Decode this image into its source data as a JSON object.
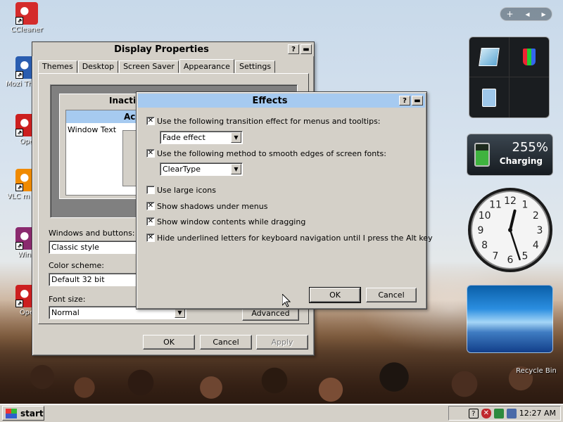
{
  "desktop_icons": [
    {
      "label": "CCleaner",
      "icon": "ccleaner-icon",
      "color": "#d42b2b"
    },
    {
      "label": "Mozi Thunde",
      "icon": "thunderbird-icon",
      "color": "#2a5db0"
    },
    {
      "label": "Ope",
      "icon": "opera-icon",
      "color": "#cc1f1f"
    },
    {
      "label": "VLC m play",
      "icon": "vlc-icon",
      "color": "#f08a00"
    },
    {
      "label": "WinR",
      "icon": "winrar-icon",
      "color": "#8a2a6e"
    },
    {
      "label": "Ope",
      "icon": "opera-icon",
      "color": "#cc1f1f"
    }
  ],
  "display_properties": {
    "title": "Display Properties",
    "help_label": "?",
    "tabs": [
      "Themes",
      "Desktop",
      "Screen Saver",
      "Appearance",
      "Settings"
    ],
    "active_tab": "Appearance",
    "preview": {
      "inactive_title": "Inacti",
      "active_title": "Ac",
      "window_text": "Window Text"
    },
    "windows_buttons_label": "Windows and buttons:",
    "windows_buttons_value": "Classic style",
    "color_scheme_label": "Color scheme:",
    "color_scheme_value": "Default 32 bit",
    "font_size_label": "Font size:",
    "font_size_value": "Normal",
    "advanced_label": "Advanced",
    "ok_label": "OK",
    "cancel_label": "Cancel",
    "apply_label": "Apply"
  },
  "effects": {
    "title": "Effects",
    "help_label": "?",
    "transition_label": "Use the following transition effect for menus and tooltips:",
    "transition_checked": true,
    "transition_value": "Fade effect",
    "smooth_label": "Use the following method to smooth edges of screen fonts:",
    "smooth_checked": true,
    "smooth_value": "ClearType",
    "large_icons_label": "Use large icons",
    "large_icons_checked": false,
    "shadows_label": "Show shadows under menus",
    "shadows_checked": true,
    "drag_label": "Show window contents while dragging",
    "drag_checked": true,
    "underline_label": "Hide underlined letters for keyboard navigation until I press the Alt key",
    "underline_checked": true,
    "ok_label": "OK",
    "cancel_label": "Cancel",
    "title_color": "#a6caf0"
  },
  "gadgets": {
    "top_controls": [
      "+",
      "◂",
      "▸"
    ],
    "battery_percent": "255%",
    "battery_status": "Charging",
    "clock_time": "12:27"
  },
  "recycle_bin_label": "Recycle Bin",
  "taskbar": {
    "start_label": "start",
    "time": "12:27 AM",
    "tray_icons": [
      "help-icon",
      "shield-icon",
      "network-icon",
      "connections-icon"
    ]
  }
}
